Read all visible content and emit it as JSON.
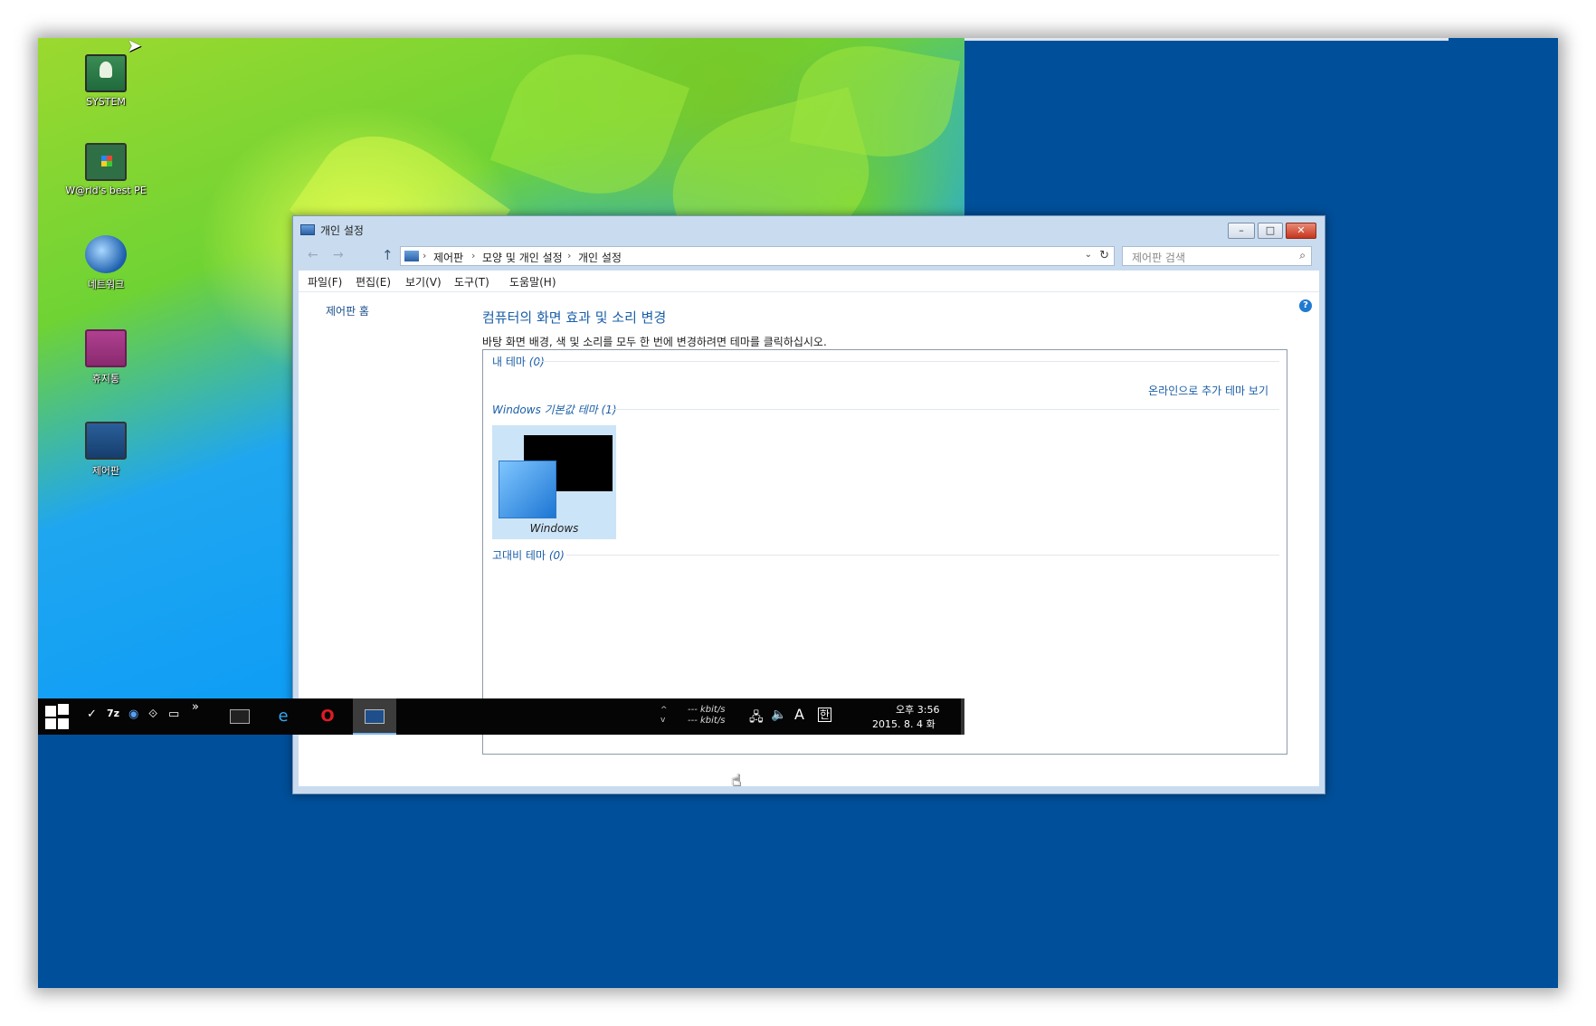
{
  "desktop": {
    "icons": [
      {
        "label": "SYSTEM"
      },
      {
        "label": "W@rld's best  PE"
      },
      {
        "label": "네트워크"
      },
      {
        "label": "휴지통"
      },
      {
        "label": "제어판"
      }
    ]
  },
  "window": {
    "title": "개인 설정",
    "controls": {
      "minimize": "–",
      "maximize": "□",
      "close": "✕"
    },
    "nav": {
      "back": "←",
      "forward": "→",
      "up": "↑"
    },
    "breadcrumb": [
      "제어판",
      "모양 및 개인 설정",
      "개인 설정"
    ],
    "breadcrumb_sep": "›",
    "search_placeholder": "제어판 검색",
    "menu": [
      "파일(F)",
      "편집(E)",
      "보기(V)",
      "도구(T)",
      "도움말(H)"
    ],
    "left_nav": {
      "home": "제어판 홈"
    },
    "heading": "컴퓨터의 화면 효과 및 소리 변경",
    "description": "바탕 화면 배경, 색 및 소리를 모두 한 번에 변경하려면 테마를 클릭하십시오.",
    "groups": {
      "my_themes": {
        "name": "내 테마",
        "count": "(0)"
      },
      "more_online": "온라인으로 추가 테마 보기",
      "windows_default": {
        "name": "Windows 기본값 테마",
        "count": "(1)"
      },
      "high_contrast": {
        "name": "고대비 테마",
        "count": "(0)"
      }
    },
    "themes": [
      {
        "name": "Windows"
      }
    ],
    "help": "?"
  },
  "taskbar": {
    "quick_launch": [
      "✓",
      "7z",
      "◉",
      "⟐",
      "▭",
      "»"
    ],
    "net": {
      "up_arrow": "^",
      "down_arrow": "v",
      "upload": "--- kbit/s",
      "download": "--- kbit/s"
    },
    "tray": {
      "network": "🖧",
      "volume": "🔈",
      "ime": "A",
      "lang": "한"
    },
    "clock_time": "오후 3:56",
    "clock_date": "2015. 8. 4 화"
  },
  "colors": {
    "desktop_background": "#004f9a",
    "accent_link": "#1b5fa8",
    "selection": "#cce4f7",
    "taskbar": "#050505"
  },
  "icons": {
    "start": "windows-logo-icon",
    "cmd": "command-prompt-icon",
    "ie": "internet-explorer-icon",
    "opera": "opera-icon",
    "control_panel": "control-panel-icon"
  }
}
